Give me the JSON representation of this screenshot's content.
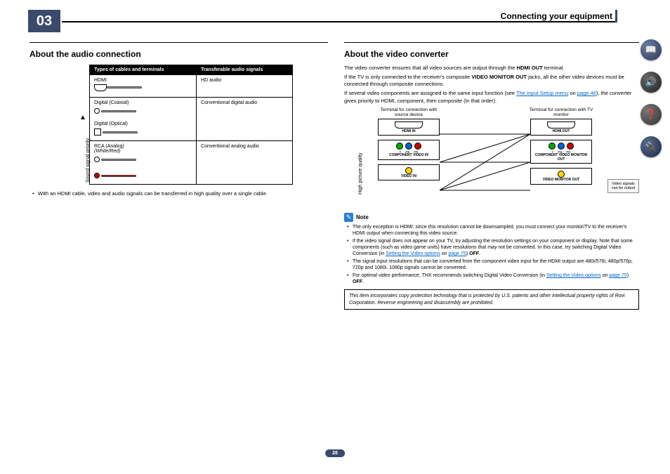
{
  "chapter": "03",
  "headerTitle": "Connecting your equipment",
  "pageNumber": "28",
  "left": {
    "heading": "About the audio connection",
    "rotated": "Sound signal priority",
    "table": {
      "headers": [
        "Types of cables and terminals",
        "Transferable audio signals"
      ],
      "rows": [
        {
          "c1": "HDMI",
          "c2": "HD audio"
        },
        {
          "c1": "Digital (Coaxial)",
          "c2": "Conventional digital audio",
          "c1b": "Digital (Optical)"
        },
        {
          "c1": "RCA (Analog)",
          "c1i": "(White/Red)",
          "c2": "Conventional analog audio"
        }
      ]
    },
    "bullet": "With an HDMI cable, video and audio signals can be transferred in high quality over a single cable."
  },
  "right": {
    "heading": "About the video converter",
    "p1_a": "The video converter ensures that all video sources are output through the ",
    "p1_b": "HDMI OUT",
    "p1_c": " terminal.",
    "p2_a": "If the TV is only connected to the receiver's composite ",
    "p2_b": "VIDEO MONITOR OUT",
    "p2_c": " jacks, all the other video devices must be connected through composite connections.",
    "p3_a": "If several video components are assigned to the same input function (see ",
    "p3_link1": "The Input Setup menu",
    "p3_b": " on ",
    "p3_link2": "page 46",
    "p3_c": "), the converter gives priority to HDMI, component, then composite (in that order).",
    "diagram": {
      "leftCap": "Terminal for connection with source device",
      "rightCap": "Terminal for connection with TV monitor",
      "rotated": "High picture quality",
      "labels": {
        "hdmiIn": "HDMI IN",
        "hdmiOut": "HDMI OUT",
        "compIn": "COMPONENT VIDEO IN",
        "compOut": "COMPONENT VIDEO MONITOR OUT",
        "vidIn": "VIDEO IN",
        "vidOut": "VIDEO MONITOR OUT",
        "y": "Y",
        "pb": "PB",
        "pr": "PR"
      },
      "outNote": "Video signals can be output"
    },
    "noteLabel": "Note",
    "notes": {
      "n1": "The only exception is HDMI: since this resolution cannot be downsampled, you must connect your monitor/TV to the receiver's HDMI output when connecting this video source.",
      "n2_a": "If the video signal does not appear on your TV, try adjusting the resolution settings on your component or display. Note that some components (such as video game units) have resolutions that may not be converted. In this case, try switching Digital Video Conversion (in ",
      "n2_link": "Setting the Video options",
      "n2_b": " on ",
      "n2_link2": "page 75",
      "n2_c": ") ",
      "off": "OFF",
      "n3": "The signal input resolutions that can be converted from the component video input for the HDMI output are 480i/576i, 480p/576p, 720p and 1080i. 1080p signals cannot be converted.",
      "n4_a": "For optimal video performance, THX recommends switching Digital Video Conversion (in ",
      "n4_link": "Setting the Video options",
      "n4_b": " on ",
      "n4_link2": "page 75",
      "n4_c": ") "
    },
    "legal": "This item incorporates copy protection technology that is protected by U.S. patents and other intellectual property rights of Rovi Corporation. Reverse engineering and disassembly are prohibited."
  },
  "sideIcons": [
    "book",
    "speaker",
    "help",
    "net"
  ]
}
